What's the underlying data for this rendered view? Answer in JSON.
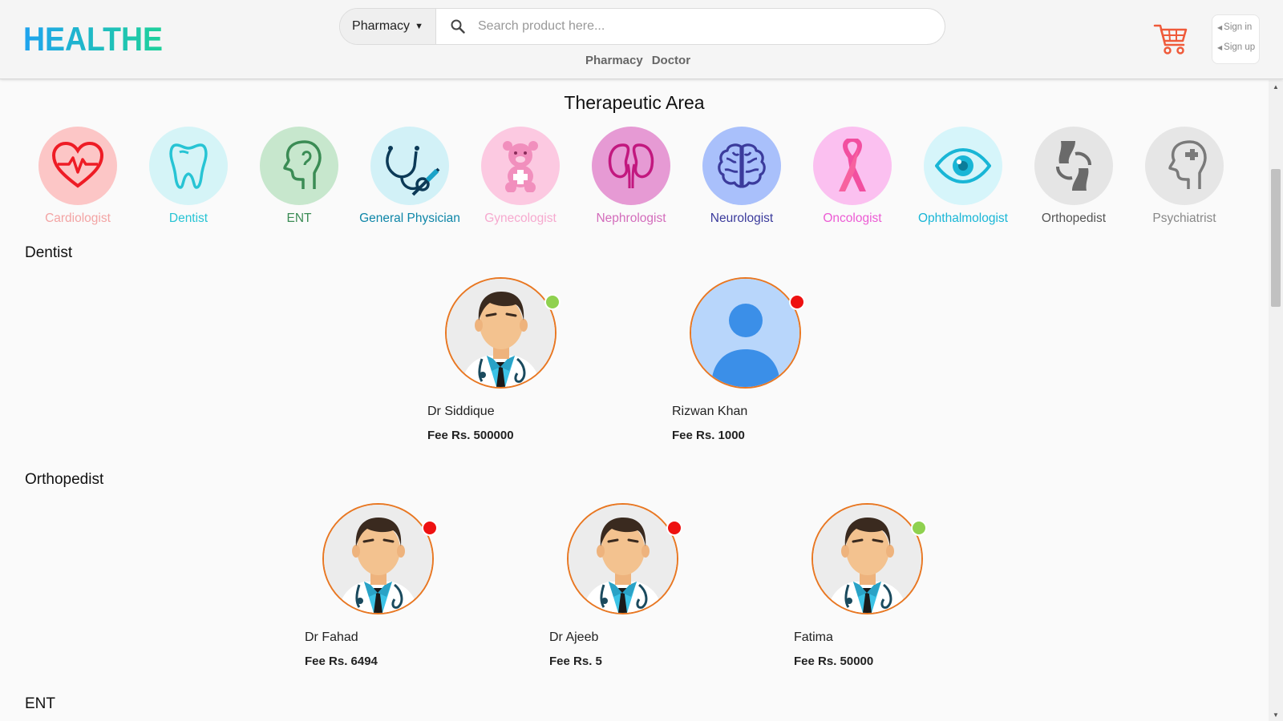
{
  "brand": {
    "logo_text": "HEALTHE",
    "logo_gradient": [
      "#1fa3ef",
      "#1fd19a"
    ]
  },
  "search": {
    "category": "Pharmacy",
    "placeholder": "Search product here..."
  },
  "header_links": [
    "Pharmacy",
    "Doctor"
  ],
  "auth": {
    "sign_in": "Sign in",
    "sign_up": "Sign up"
  },
  "therapeutic": {
    "title": "Therapeutic Area",
    "items": [
      {
        "label": "Cardiologist",
        "icon": "heart-icon",
        "color": "#f3a4a4",
        "bg": "#fcc6c6"
      },
      {
        "label": "Dentist",
        "icon": "tooth-icon",
        "color": "#27c4d4",
        "bg": "#d5f4f7"
      },
      {
        "label": "ENT",
        "icon": "head-ear-icon",
        "color": "#3b8c55",
        "bg": "#c7e7cd"
      },
      {
        "label": "General Physician",
        "icon": "stethoscope-icon",
        "color": "#0e86a8",
        "bg": "#d2f1f7"
      },
      {
        "label": "Gynecologist",
        "icon": "teddy-bear-icon",
        "color": "#f6a9cf",
        "bg": "#fcc9e1"
      },
      {
        "label": "Nephrologist",
        "icon": "kidney-icon",
        "color": "#d36cbb",
        "bg": "#e69ad4"
      },
      {
        "label": "Neurologist",
        "icon": "brain-icon",
        "color": "#3b3b9c",
        "bg": "#a9c0fb"
      },
      {
        "label": "Oncologist",
        "icon": "ribbon-icon",
        "color": "#ec5bd4",
        "bg": "#fbc0f0"
      },
      {
        "label": "Ophthalmologist",
        "icon": "eye-icon",
        "color": "#19b6d6",
        "bg": "#d6f5fa"
      },
      {
        "label": "Orthopedist",
        "icon": "joint-icon",
        "color": "#555555",
        "bg": "#e5e5e5"
      },
      {
        "label": "Psychiatrist",
        "icon": "mind-icon",
        "color": "#888888",
        "bg": "#e6e6e6"
      }
    ]
  },
  "sections": [
    {
      "title": "Dentist",
      "doctors": [
        {
          "name": "Dr Siddique",
          "fee": "Fee Rs. 500000",
          "avatar": "doctor-avatar",
          "status": "online"
        },
        {
          "name": "Rizwan Khan",
          "fee": "Fee Rs. 1000",
          "avatar": "user-placeholder-avatar",
          "status": "offline"
        }
      ]
    },
    {
      "title": "Orthopedist",
      "doctors": [
        {
          "name": "Dr Fahad",
          "fee": "Fee Rs. 6494",
          "avatar": "doctor-avatar",
          "status": "offline"
        },
        {
          "name": "Dr Ajeeb",
          "fee": "Fee Rs. 5",
          "avatar": "doctor-avatar",
          "status": "offline"
        },
        {
          "name": "Fatima",
          "fee": "Fee Rs. 50000",
          "avatar": "doctor-avatar",
          "status": "online"
        }
      ]
    },
    {
      "title": "ENT",
      "doctors": []
    }
  ],
  "status_colors": {
    "online": "#8fd14f",
    "offline": "#ee1111"
  },
  "accent": "#e87722"
}
